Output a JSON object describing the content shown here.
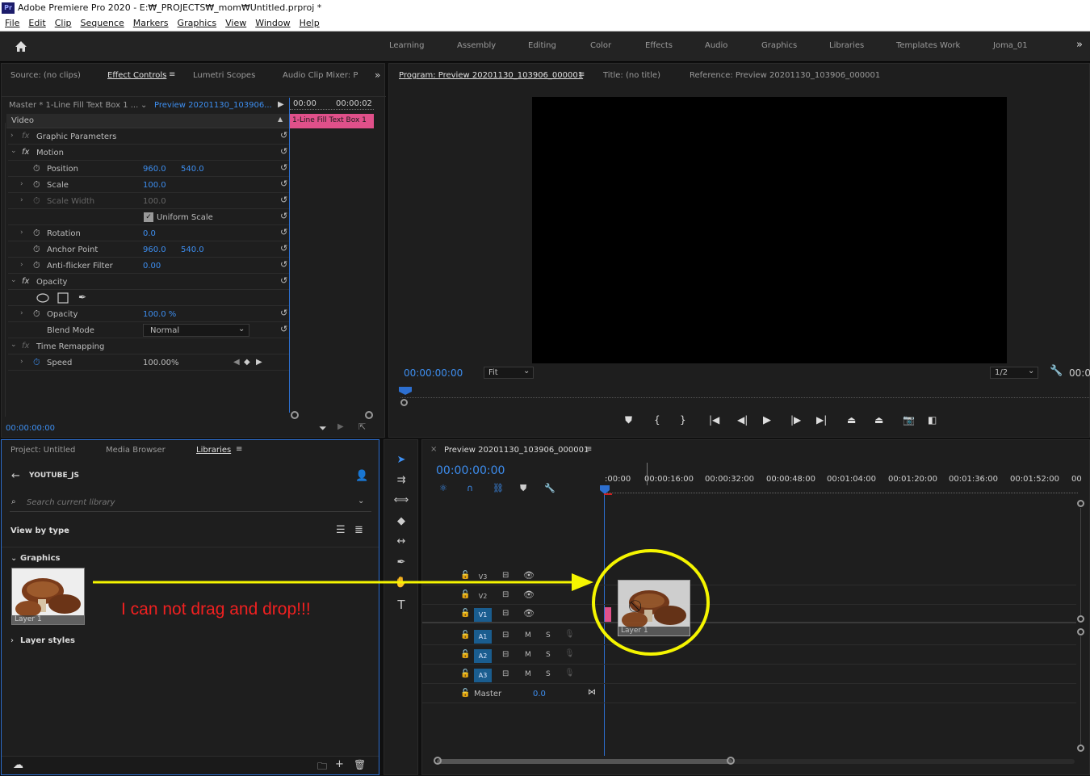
{
  "app": {
    "title": "Adobe Premiere Pro 2020 - E:₩_PROJECTS₩_mom₩Untitled.prproj *",
    "logo": "Pr"
  },
  "menu": [
    "File",
    "Edit",
    "Clip",
    "Sequence",
    "Markers",
    "Graphics",
    "View",
    "Window",
    "Help"
  ],
  "workspaces": [
    "Learning",
    "Assembly",
    "Editing",
    "Color",
    "Effects",
    "Audio",
    "Graphics",
    "Libraries",
    "Templates Work",
    "Joma_01"
  ],
  "source_panel": {
    "tabs": [
      "Source: (no clips)",
      "Effect Controls",
      "Lumetri Scopes",
      "Audio Clip Mixer: P"
    ],
    "master": "Master * 1-Line Fill Text Box 1 ...",
    "preview": "Preview 20201130_103906...",
    "time_start": "00:00",
    "time_end": "00:00:02",
    "clip_label": "1-Line Fill Text Box 1",
    "section": "Video",
    "rows": [
      {
        "name": "Graphic Parameters"
      },
      {
        "name": "Motion"
      },
      {
        "name": "Position",
        "v1": "960.0",
        "v2": "540.0"
      },
      {
        "name": "Scale",
        "v1": "100.0"
      },
      {
        "name": "Scale Width",
        "v1": "100.0"
      },
      {
        "name": "Uniform Scale"
      },
      {
        "name": "Rotation",
        "v1": "0.0"
      },
      {
        "name": "Anchor Point",
        "v1": "960.0",
        "v2": "540.0"
      },
      {
        "name": "Anti-flicker Filter",
        "v1": "0.00"
      },
      {
        "name": "Opacity"
      },
      {
        "name": "Opacity",
        "v1": "100.0 %"
      },
      {
        "name": "Blend Mode",
        "v1": "Normal"
      },
      {
        "name": "Time Remapping"
      },
      {
        "name": "Speed",
        "v1": "100.00%"
      }
    ],
    "timecode": "00:00:00:00"
  },
  "program": {
    "tabs": [
      "Program: Preview 20201130_103906_000001",
      "Title: (no title)",
      "Reference: Preview 20201130_103906_000001"
    ],
    "timecode": "00:00:00:00",
    "fit": "Fit",
    "resolution": "1/2",
    "end_timecode": "00:0"
  },
  "project": {
    "tabs": [
      "Project: Untitled",
      "Media Browser",
      "Libraries"
    ],
    "library": "YOUTUBE_JS",
    "search_placeholder": "Search current library",
    "view_by": "View by type",
    "group_graphics": "Graphics",
    "thumb_label": "Layer 1",
    "group_layers": "Layer styles"
  },
  "annotation": {
    "text": "I can not drag and drop!!!",
    "color": "#f02020",
    "arrow_color": "#f5f500"
  },
  "timeline": {
    "tab": "Preview 20201130_103906_000001",
    "timecode": "00:00:00:00",
    "ruler": [
      ":00:00",
      "00:00:16:00",
      "00:00:32:00",
      "00:00:48:00",
      "00:01:04:00",
      "00:01:20:00",
      "00:01:36:00",
      "00:01:52:00",
      "00"
    ],
    "video_tracks": [
      "V3",
      "V2",
      "V1"
    ],
    "audio_tracks": [
      "A1",
      "A2",
      "A3"
    ],
    "master_label": "Master",
    "master_value": "0.0",
    "M": "M",
    "S": "S",
    "drag_label": "Layer 1"
  }
}
